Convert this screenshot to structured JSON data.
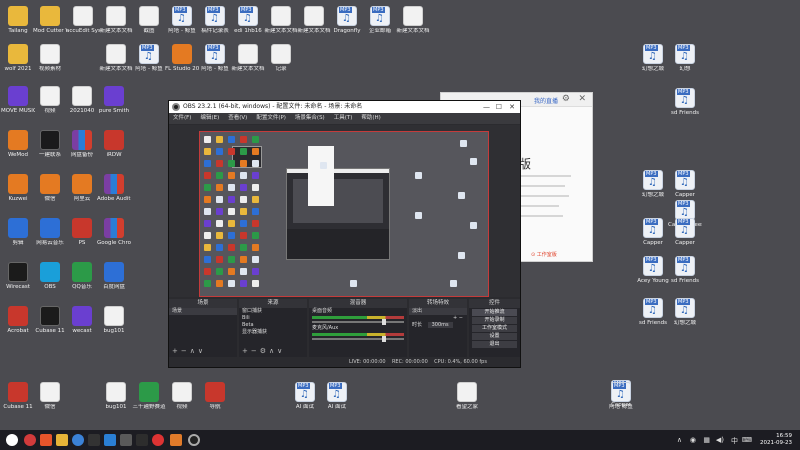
{
  "desktop": {
    "icons": [
      {
        "label": "Tailang",
        "kind": "folder"
      },
      {
        "label": "Mod Cutter Windows",
        "kind": "folder"
      },
      {
        "label": "accuEdit Systems",
        "kind": "doc"
      },
      {
        "label": "新建文本文档",
        "kind": "doc"
      },
      {
        "label": "截图",
        "kind": "doc"
      },
      {
        "label": "阿塔 - 鲸鱼",
        "kind": "mp3"
      },
      {
        "label": "稿件记录表",
        "kind": "mp3"
      },
      {
        "label": "edi 1hb16",
        "kind": "mp3"
      },
      {
        "label": "新建文本文档",
        "kind": "doc"
      },
      {
        "label": "新建文本文档",
        "kind": "doc"
      },
      {
        "label": "Dragonfly",
        "kind": "mp3"
      },
      {
        "label": "企业邮箱",
        "kind": "mp3"
      },
      {
        "label": "新建文本文档",
        "kind": "doc"
      },
      {
        "label": "wolf 2021",
        "kind": "folder"
      },
      {
        "label": "视频素材",
        "kind": "doc"
      },
      {
        "label": "新建文本文档",
        "kind": "doc"
      },
      {
        "label": "阿塔 - 鲸鱼",
        "kind": "mp3"
      },
      {
        "label": "FL Studio 20",
        "kind": "orange"
      },
      {
        "label": "阿塔 - 鲸鱼",
        "kind": "mp3"
      },
      {
        "label": "新建文本文档",
        "kind": "doc"
      },
      {
        "label": "记录",
        "kind": "doc"
      }
    ],
    "side_labels": [
      "MOVE MUSIC",
      "视频",
      "2021040",
      "pure Smith",
      "WeMod",
      "一建联系",
      "网盘备份",
      "iRDW",
      "Kuzwei",
      "微信",
      "阿里云",
      "Adobe Audition 2020",
      "剪辑",
      "网易云音乐",
      "PS",
      "Google Chrome",
      "Wirecast",
      "OBS",
      "QQ音乐",
      "百度网盘",
      "Acrobat",
      "Cubase 11",
      "wecast",
      "bug101"
    ],
    "right_column": [
      {
        "label": "幻想之城",
        "kind": "mp3"
      },
      {
        "label": "幻想",
        "kind": "mp3"
      },
      {
        "label": "sd Friends",
        "kind": "mp3"
      },
      {
        "label": "Capper",
        "kind": "mp3"
      },
      {
        "label": "Capper Freestyle",
        "kind": "mp3"
      },
      {
        "label": "幻想之城",
        "kind": "mp3"
      },
      {
        "label": "Capper",
        "kind": "mp3"
      },
      {
        "label": "Capper",
        "kind": "mp3"
      },
      {
        "label": "Acey Young",
        "kind": "mp3"
      },
      {
        "label": "sd Friends",
        "kind": "mp3"
      },
      {
        "label": "sd Friends",
        "kind": "mp3"
      },
      {
        "label": "幻想之城",
        "kind": "mp3"
      },
      {
        "label": "Capper",
        "kind": "mp3"
      }
    ],
    "bottom_icons": [
      {
        "label": "Cubase 11",
        "kind": "red"
      },
      {
        "label": "微信",
        "kind": "doc"
      },
      {
        "label": "bug101",
        "kind": "doc"
      },
      {
        "label": "三千越野赛道",
        "kind": "green"
      },
      {
        "label": "视频",
        "kind": "doc"
      },
      {
        "label": "导航",
        "kind": "red"
      },
      {
        "label": "AI 面试",
        "kind": "mp3"
      },
      {
        "label": "AI 面试",
        "kind": "mp3"
      },
      {
        "label": "看望之家",
        "kind": "doc"
      },
      {
        "label": "阿塔 鲸鱼",
        "kind": "mp3"
      }
    ]
  },
  "side_dialog": {
    "link": "我的直播",
    "heading": "版",
    "warning": "⊙ 工作室版"
  },
  "obs": {
    "title": "OBS 23.2.1 (64-bit, windows) - 配置文件: 未命名 - 场景: 未命名",
    "menu": [
      "文件(F)",
      "编辑(E)",
      "查看(V)",
      "配置文件(P)",
      "场景集合(S)",
      "工具(T)",
      "帮助(H)"
    ],
    "docks": {
      "scenes": {
        "title": "场景",
        "items": [
          "场景"
        ]
      },
      "sources": {
        "title": "来源",
        "items": [
          "窗口捕获",
          "Bili",
          "Beta",
          "显示器捕获"
        ]
      },
      "mixer": {
        "title": "混音器",
        "tracks": [
          {
            "name": "桌面音频",
            "db": "0.0 dB"
          },
          {
            "name": "麦克风/Aux",
            "db": "0.0 dB"
          }
        ]
      },
      "transitions": {
        "title": "转场特效",
        "type": "淡出",
        "duration_label": "时长",
        "duration": "300ms"
      },
      "controls": {
        "title": "控件",
        "buttons": [
          "开始推流",
          "开始录制",
          "工作室模式",
          "设置",
          "退出"
        ]
      }
    },
    "status": {
      "live": "LIVE: 00:00:00",
      "rec": "REC: 00:00:00",
      "cpu": "CPU: 0.4%, 60.00 fps"
    }
  },
  "taskbar": {
    "time": "16:59",
    "date": "2021-09-23"
  }
}
